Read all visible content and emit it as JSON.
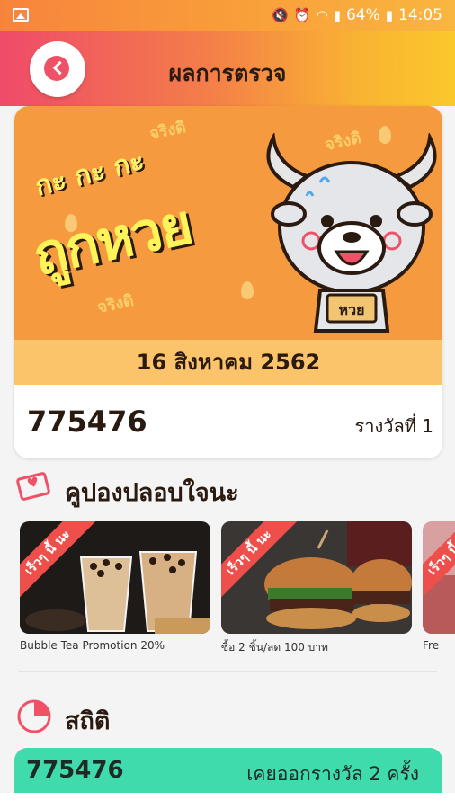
{
  "status_bar": {
    "battery": "64%",
    "time": "14:05"
  },
  "header": {
    "title": "ผลการตรวจ"
  },
  "banner": {
    "tagline": "กะ กะ กะ",
    "headline": "ถูกหวย",
    "watermark": "จริงดิ",
    "mascot_tag": "หวย"
  },
  "result": {
    "draw_date": "16 สิงหาคม 2562",
    "number": "775476",
    "prize": "รางวัลที่ 1"
  },
  "coupon_section": {
    "title": "คูปองปลอบใจนะ",
    "ribbon": "เร็วๆ นี้ นะ",
    "items": [
      {
        "caption": "Bubble Tea Promotion 20%"
      },
      {
        "caption": "ซื้อ 2 ชิ้น/ลด 100 บาท"
      },
      {
        "caption": "Fre"
      }
    ]
  },
  "stats_section": {
    "title": "สถิติ",
    "number": "775476",
    "description": "เคยออกรางวัล  2  ครั้ง"
  },
  "colors": {
    "accent": "#ef5266",
    "banner": "#f59a3f",
    "stat_bar": "#3fdbad"
  }
}
